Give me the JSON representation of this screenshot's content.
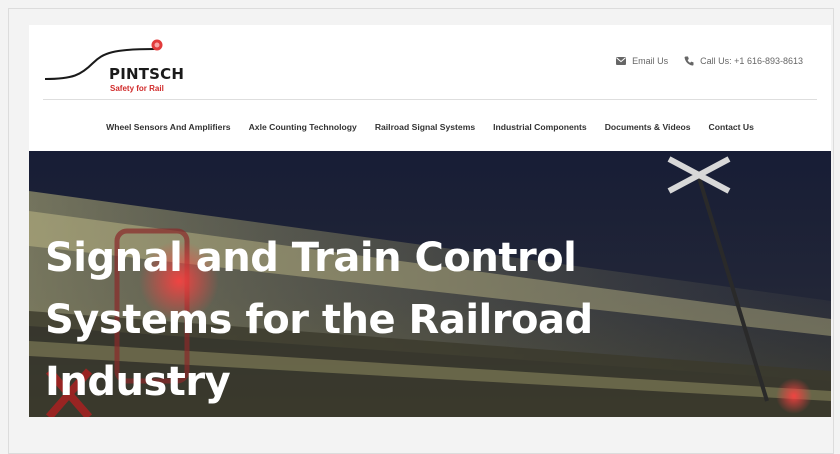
{
  "brand": {
    "name": "PINTSCH",
    "tagline": "Safety for Rail",
    "accent_color": "#d12b2b"
  },
  "contact": {
    "email_label": "Email Us",
    "email_icon": "envelope-icon",
    "phone_label": "Call Us: +1 616-893-8613",
    "phone_icon": "phone-icon"
  },
  "nav": {
    "items": [
      {
        "label": "Wheel Sensors And Amplifiers"
      },
      {
        "label": "Axle Counting Technology"
      },
      {
        "label": "Railroad Signal Systems"
      },
      {
        "label": "Industrial Components"
      },
      {
        "label": "Documents & Videos"
      },
      {
        "label": "Contact Us"
      }
    ]
  },
  "hero": {
    "line1": "Signal and Train Control",
    "line2": "Systems for the Railroad",
    "line3": "Industry"
  }
}
